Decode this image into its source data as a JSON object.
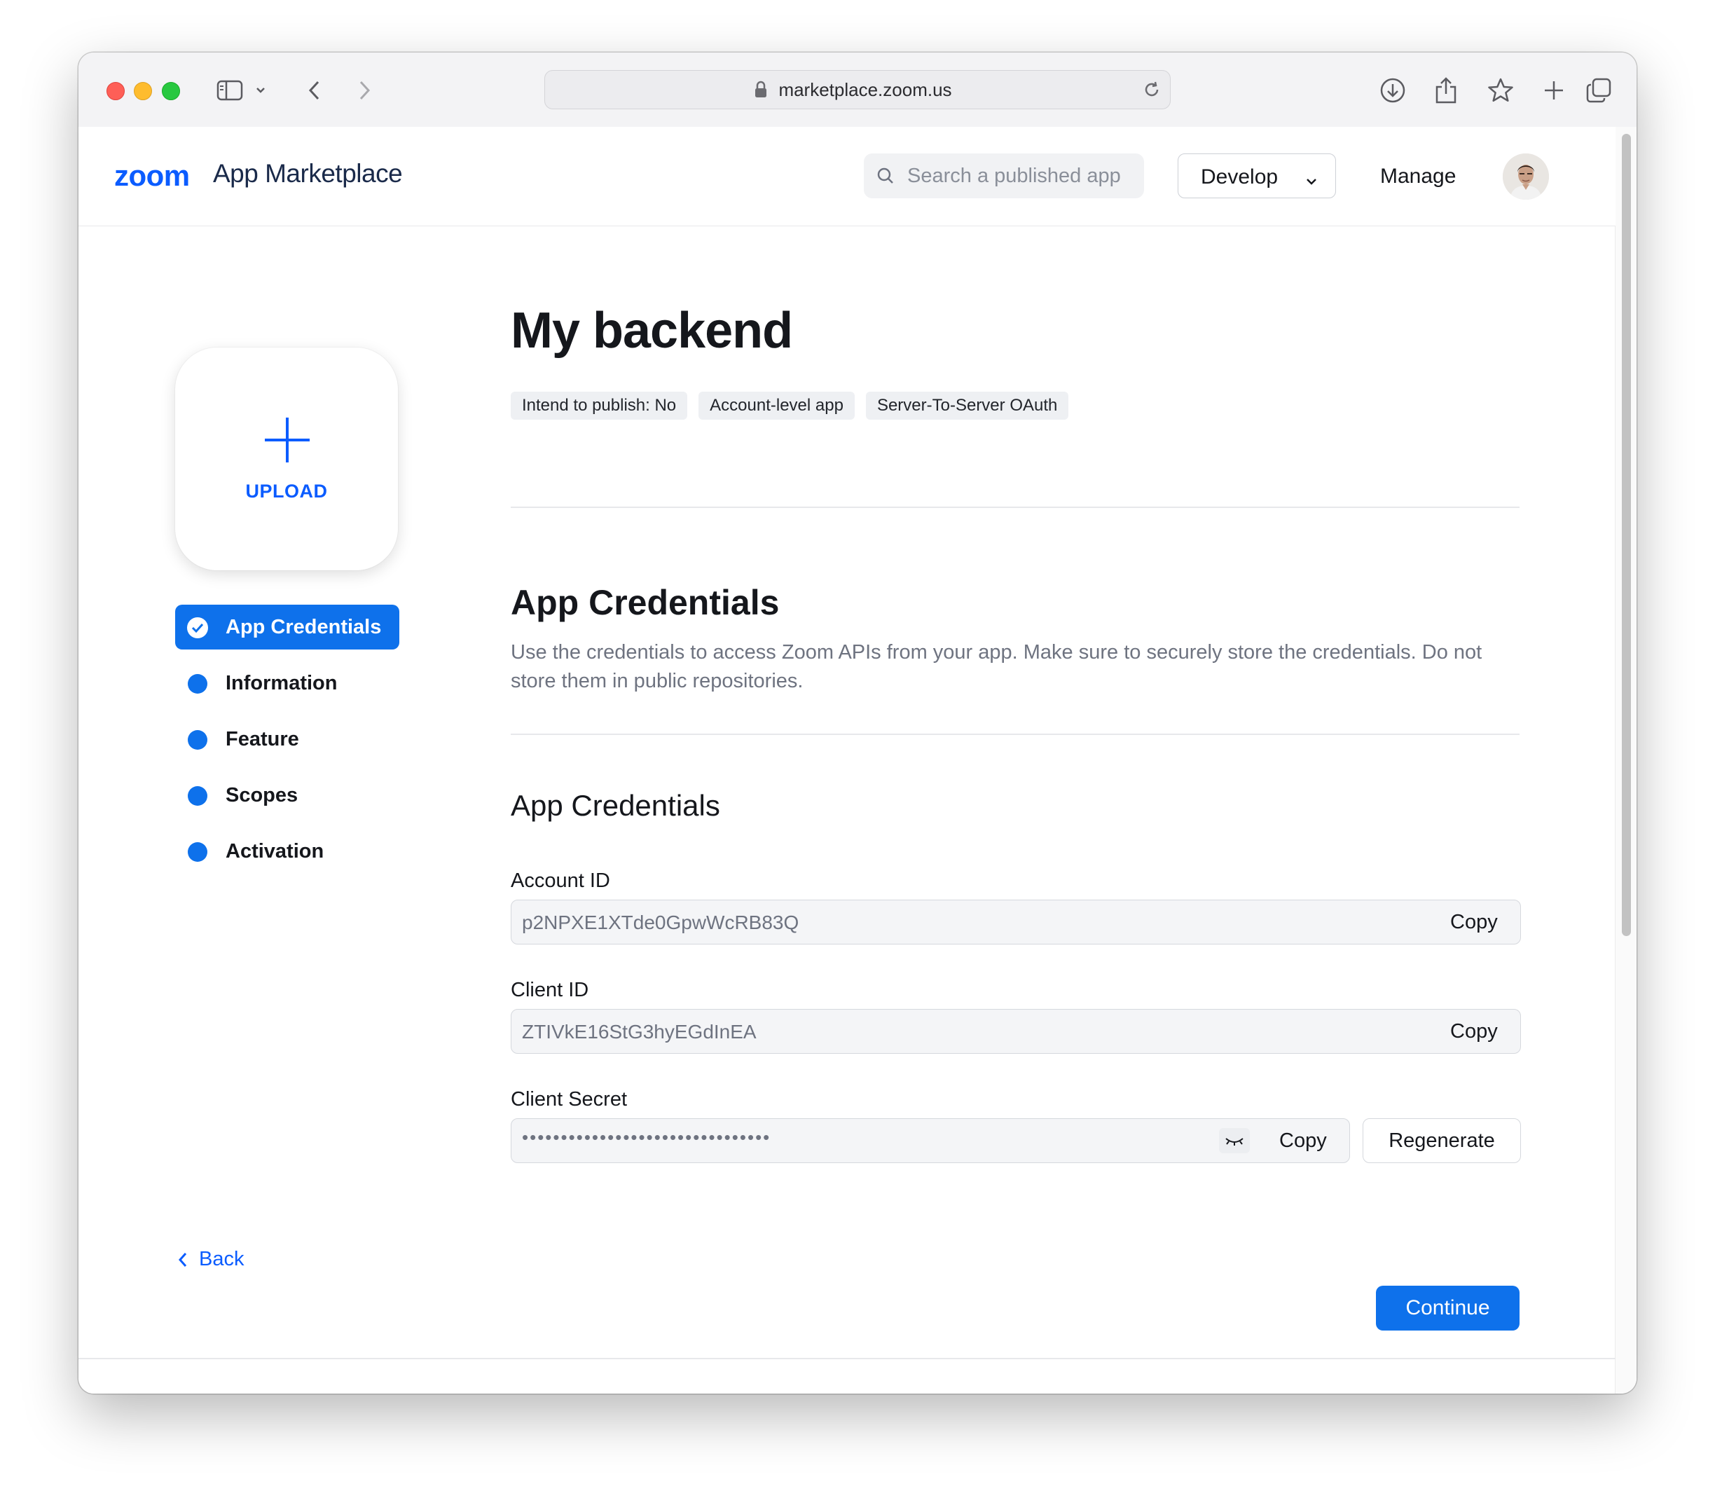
{
  "browser": {
    "url": "marketplace.zoom.us",
    "icons": {
      "sidebar": "sidebar-icon",
      "back": "chevron-left-icon",
      "forward": "chevron-right-icon",
      "lock": "lock-icon",
      "reload": "reload-icon",
      "download": "download-icon",
      "share": "share-icon",
      "bookmark": "star-icon",
      "new_tab": "plus-icon",
      "tabs": "tabs-overview-icon"
    }
  },
  "header": {
    "logo_text": "zoom",
    "title": "App Marketplace",
    "search_placeholder": "Search a published app",
    "develop_label": "Develop",
    "manage_label": "Manage"
  },
  "sidebar": {
    "upload_label": "UPLOAD",
    "items": [
      {
        "label": "App Credentials",
        "active": true
      },
      {
        "label": "Information",
        "active": false
      },
      {
        "label": "Feature",
        "active": false
      },
      {
        "label": "Scopes",
        "active": false
      },
      {
        "label": "Activation",
        "active": false
      }
    ]
  },
  "main": {
    "app_name": "My backend",
    "tags": [
      "Intend to publish: No",
      "Account-level app",
      "Server-To-Server OAuth"
    ],
    "section_title": "App Credentials",
    "section_description": "Use the credentials to access Zoom APIs from your app. Make sure to securely store the credentials. Do not store them in public repositories.",
    "subsection_title": "App Credentials",
    "fields": {
      "account_id": {
        "label": "Account ID",
        "value": "p2NPXE1XTde0GpwWcRB83Q",
        "copy_label": "Copy"
      },
      "client_id": {
        "label": "Client ID",
        "value": "ZTIVkE16StG3hyEGdInEA",
        "copy_label": "Copy"
      },
      "client_secret": {
        "label": "Client Secret",
        "value": "••••••••••••••••••••••••••••••••",
        "copy_label": "Copy",
        "regenerate_label": "Regenerate"
      }
    }
  },
  "footer": {
    "back_label": "Back",
    "continue_label": "Continue"
  },
  "colors": {
    "accent": "#0e71eb",
    "brand": "#0b5cff"
  }
}
